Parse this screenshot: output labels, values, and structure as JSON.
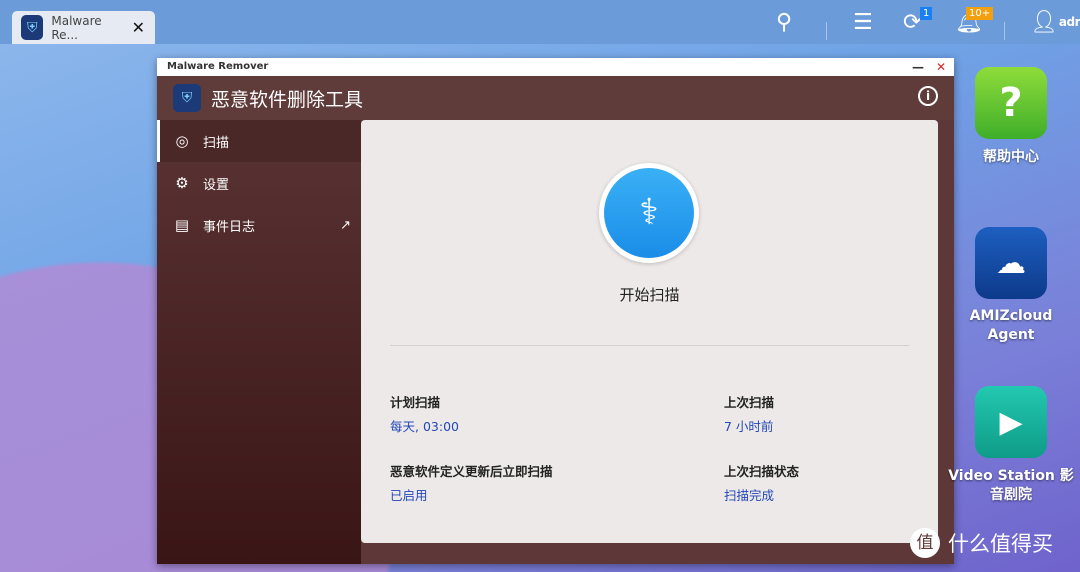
{
  "taskbar": {
    "tab_title": "Malware Re...",
    "user": "adr",
    "sync_badge": "1",
    "notif_badge": "10+"
  },
  "window": {
    "titlebar": "Malware Remover",
    "app_title": "恶意软件删除工具"
  },
  "sidebar": {
    "items": [
      {
        "label": "扫描"
      },
      {
        "label": "设置"
      },
      {
        "label": "事件日志"
      }
    ]
  },
  "main": {
    "scan_label": "开始扫描",
    "fields": [
      {
        "label": "计划扫描",
        "value": "每天, 03:00"
      },
      {
        "label": "上次扫描",
        "value": "7 小时前"
      },
      {
        "label": "恶意软件定义更新后立即扫描",
        "value": "已启用"
      },
      {
        "label": "上次扫描状态",
        "value": "扫描完成"
      }
    ]
  },
  "desktop": {
    "icons": [
      {
        "label": "帮助中心"
      },
      {
        "label": "AMIZcloud Agent"
      },
      {
        "label": "Video Station 影音剧院"
      }
    ]
  },
  "watermark": {
    "char": "值",
    "text": "什么值得买"
  }
}
